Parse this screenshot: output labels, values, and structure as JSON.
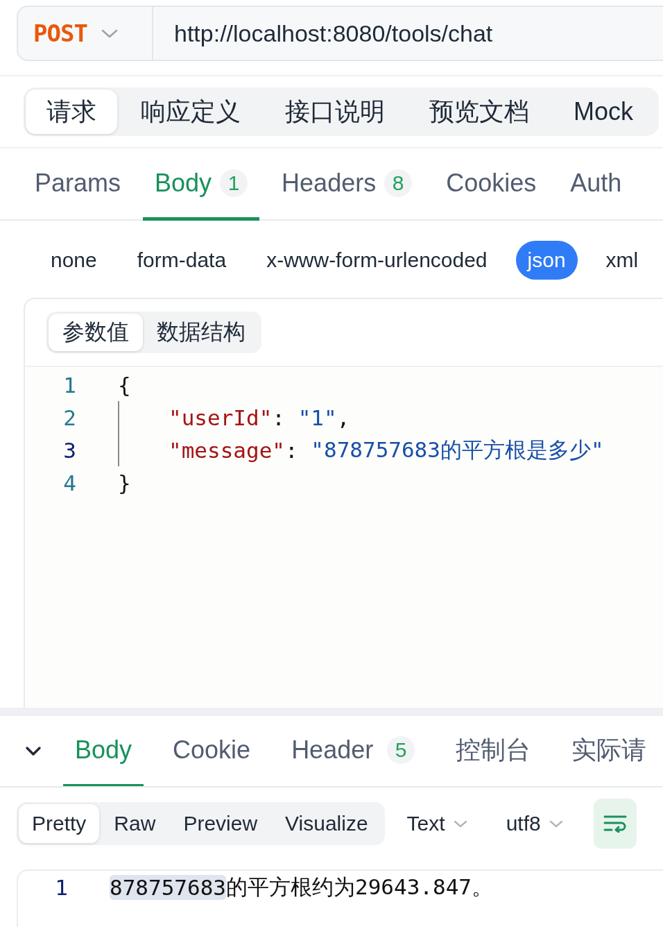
{
  "request": {
    "method": "POST",
    "url": "http://localhost:8080/tools/chat"
  },
  "view_tabs": [
    {
      "label": "请求",
      "selected": true
    },
    {
      "label": "响应定义",
      "selected": false
    },
    {
      "label": "接口说明",
      "selected": false
    },
    {
      "label": "预览文档",
      "selected": false
    },
    {
      "label": "Mock",
      "selected": false
    }
  ],
  "request_tabs": [
    {
      "label": "Params",
      "selected": false
    },
    {
      "label": "Body",
      "count": "1",
      "selected": true
    },
    {
      "label": "Headers",
      "count": "8",
      "selected": false
    },
    {
      "label": "Cookies",
      "selected": false
    },
    {
      "label": "Auth",
      "selected": false
    }
  ],
  "body_types": [
    {
      "label": "none",
      "selected": false
    },
    {
      "label": "form-data",
      "selected": false
    },
    {
      "label": "x-www-form-urlencoded",
      "selected": false
    },
    {
      "label": "json",
      "selected": true
    },
    {
      "label": "xml",
      "selected": false
    }
  ],
  "body_editor": {
    "modes": [
      {
        "label": "参数值",
        "selected": true
      },
      {
        "label": "数据结构",
        "selected": false
      }
    ],
    "lines": [
      {
        "number": "1",
        "active": false,
        "indented": false,
        "tokens": [
          {
            "kind": "punct",
            "text": "{"
          }
        ]
      },
      {
        "number": "2",
        "active": false,
        "indented": true,
        "tokens": [
          {
            "kind": "key",
            "text": "\"userId\""
          },
          {
            "kind": "punct",
            "text": ": "
          },
          {
            "kind": "string",
            "text": "\"1\""
          },
          {
            "kind": "punct",
            "text": ","
          }
        ]
      },
      {
        "number": "3",
        "active": true,
        "indented": true,
        "tokens": [
          {
            "kind": "key",
            "text": "\"message\""
          },
          {
            "kind": "punct",
            "text": ": "
          },
          {
            "kind": "string",
            "text": "\"878757683的平方根是多少\""
          }
        ]
      },
      {
        "number": "4",
        "active": false,
        "indented": false,
        "tokens": [
          {
            "kind": "punct",
            "text": "}"
          }
        ]
      }
    ]
  },
  "response": {
    "expanded": true,
    "tabs": [
      {
        "label": "Body",
        "selected": true
      },
      {
        "label": "Cookie",
        "selected": false
      },
      {
        "label": "Header",
        "count": "5",
        "selected": false
      },
      {
        "label": "控制台",
        "selected": false
      },
      {
        "label": "实际请",
        "selected": false
      }
    ],
    "view_modes": [
      {
        "label": "Pretty",
        "selected": true
      },
      {
        "label": "Raw",
        "selected": false
      },
      {
        "label": "Preview",
        "selected": false
      },
      {
        "label": "Visualize",
        "selected": false
      }
    ],
    "format": "Text",
    "encoding": "utf8",
    "word_wrap": true,
    "lines": [
      {
        "number": "1",
        "segments": [
          {
            "text": "878757683",
            "highlighted": true
          },
          {
            "text": "的平方根约为29643.847。",
            "highlighted": false
          }
        ]
      }
    ]
  }
}
